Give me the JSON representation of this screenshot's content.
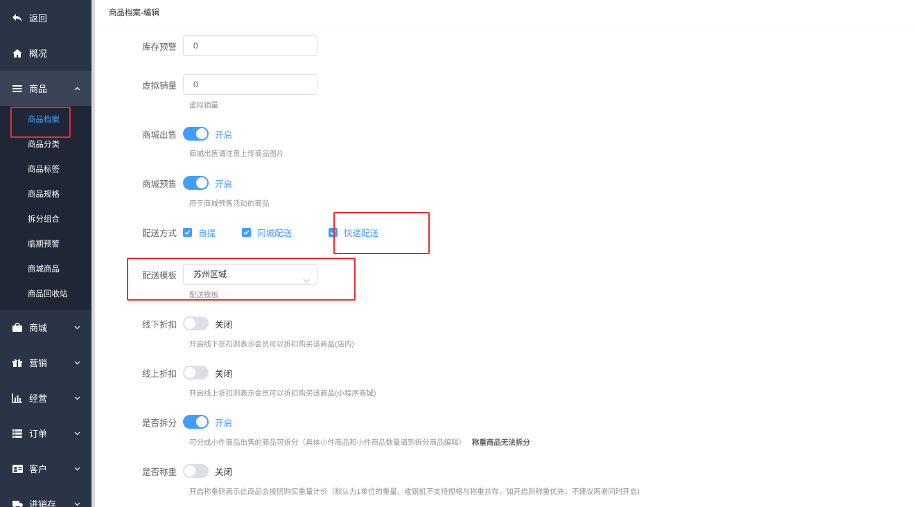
{
  "sidebar": {
    "back": "返回",
    "overview": "概况",
    "goods": "商品",
    "goods_sub": [
      "商品档案",
      "商品分类",
      "商品标签",
      "商品规格",
      "拆分组合",
      "临期预警",
      "商城商品",
      "商品回收站"
    ],
    "mall": "商城",
    "marketing": "营销",
    "operation": "经营",
    "orders": "订单",
    "customers": "客户",
    "inventory": "进销存"
  },
  "breadcrumb": "商品档案-编辑",
  "form": {
    "stock_warning": {
      "label": "库存预警",
      "value": "0"
    },
    "virtual_sales": {
      "label": "虚拟销量",
      "value": "0",
      "help": "虚拟销量"
    },
    "mall_sale": {
      "label": "商城出售",
      "state": "开启",
      "help": "商城出售请注意上传商品图片"
    },
    "mall_presale": {
      "label": "商城预售",
      "state": "开启",
      "help": "用于商城预售活动的商品"
    },
    "delivery": {
      "label": "配送方式",
      "options": [
        "自提",
        "同城配送",
        "快递配送"
      ]
    },
    "delivery_template": {
      "label": "配送模板",
      "value": "苏州区域",
      "help": "配送模板"
    },
    "offline_discount": {
      "label": "线下折扣",
      "state": "关闭",
      "help": "开启线下折扣则表示会员可以折扣购买该商品(店内)"
    },
    "online_discount": {
      "label": "线上折扣",
      "state": "关闭",
      "help": "开启线上折扣则表示会员可以折扣购买该商品(小程序商城)"
    },
    "split": {
      "label": "是否拆分",
      "state": "开启",
      "help": "可分成小件商品出售的商品可拆分（具体小件商品和小件商品数量请到拆分商品编辑）",
      "help_bold": "称重商品无法拆分"
    },
    "weigh": {
      "label": "是否称重",
      "state": "关闭",
      "help": "开启称重则表示此商品会按照购买重量计价（默认为1单位的重量，收银机不支持规格与称重并存，如开启则称重优先，不建议两者同时开启)"
    }
  },
  "colors": {
    "primary": "#409eff",
    "sidebar_bg": "#2b3446",
    "highlight": "#f02b2b"
  }
}
